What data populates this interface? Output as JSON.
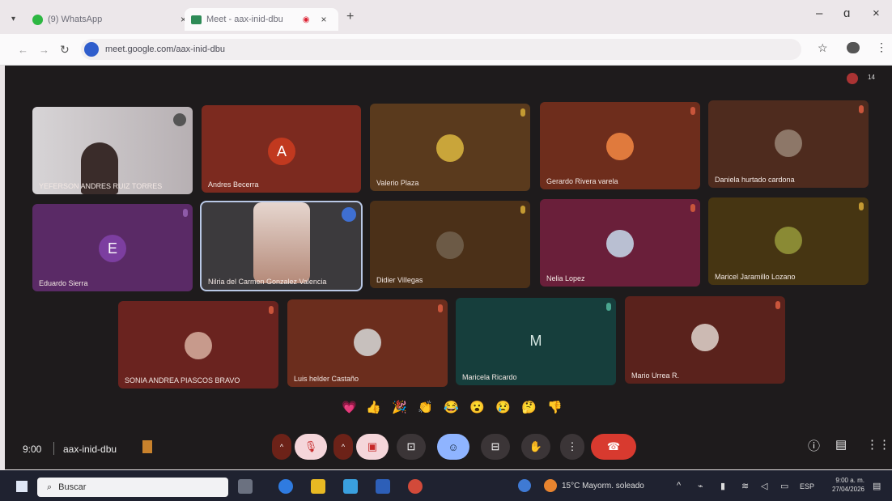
{
  "browser": {
    "tabs": [
      {
        "label": "(9) WhatsApp"
      },
      {
        "label": "Meet - aax-inid-dbu"
      }
    ],
    "url": "meet.google.com/aax-inid-dbu",
    "window_controls": {
      "minimize": "–",
      "maximize": "ɑ",
      "close": "×"
    }
  },
  "meeting": {
    "participant_count": "14",
    "code": "aax-inid-dbu",
    "time": "9:00",
    "participants": [
      {
        "name": "YEFERSON ANDRES RUIZ TORRES"
      },
      {
        "name": "Andres Becerra",
        "initial": "A"
      },
      {
        "name": "Valerio Plaza"
      },
      {
        "name": "Gerardo Rivera varela"
      },
      {
        "name": "Daniela hurtado cardona"
      },
      {
        "name": "Eduardo Sierra",
        "initial": "E"
      },
      {
        "name": "Nilria del Carmen Gonzalez Valencia"
      },
      {
        "name": "Didier Villegas"
      },
      {
        "name": "Nelia Lopez"
      },
      {
        "name": "Maricel Jaramillo Lozano"
      },
      {
        "name": "SONIA ANDREA PIASCOS BRAVO"
      },
      {
        "name": "Luis helder Castaño"
      },
      {
        "name": "Maricela Ricardo",
        "initial": "M"
      },
      {
        "name": "Mario Urrea R."
      }
    ],
    "reactions": [
      "💗",
      "👍",
      "🎉",
      "👏",
      "😂",
      "😮",
      "😢",
      "🤔",
      "👎"
    ]
  },
  "taskbar": {
    "search_placeholder": "Buscar",
    "weather": "15°C  Mayorm. soleado",
    "lang": "ESP",
    "clock_time": "9:00 a. m.",
    "clock_date": "27/04/2026"
  }
}
